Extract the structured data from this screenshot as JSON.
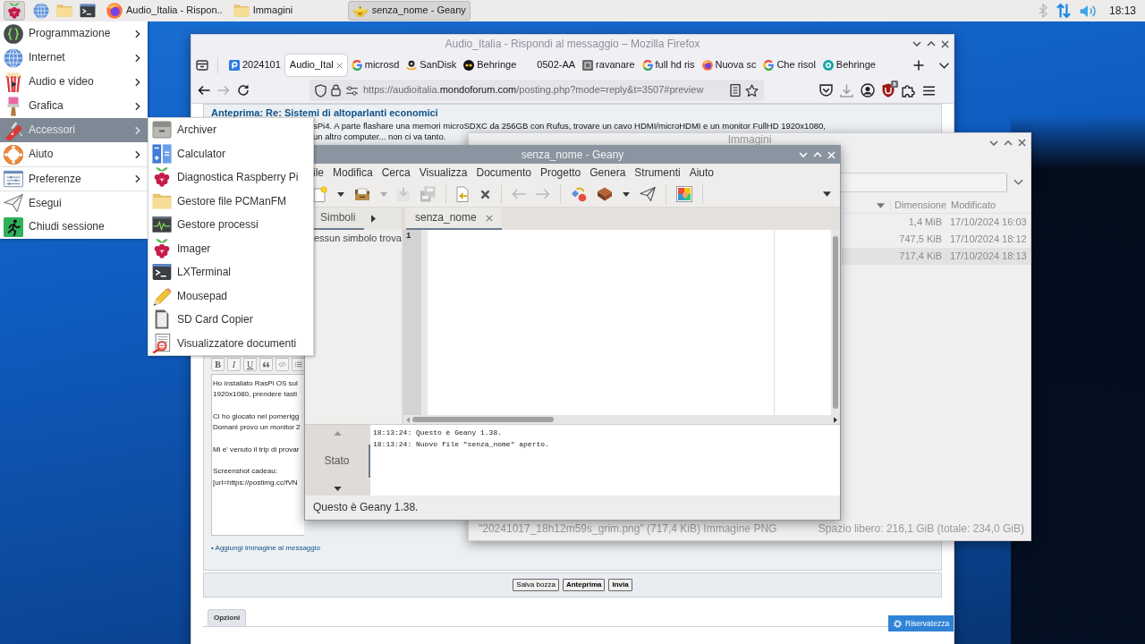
{
  "taskbar": {
    "launchers": [
      {
        "kind": "raspberry",
        "selected": true
      },
      {
        "kind": "globe",
        "selected": false
      },
      {
        "kind": "folder",
        "selected": false
      },
      {
        "kind": "terminal",
        "selected": false
      }
    ],
    "tasks": [
      {
        "kind": "firefox",
        "label": "Audio_Italia - Rispon..",
        "selected": false
      },
      {
        "kind": "folder",
        "label": "Immagini",
        "selected": false
      },
      {
        "kind": "teapot",
        "label": "senza_nome - Geany",
        "selected": true
      }
    ],
    "tray": {
      "bluetooth_enabled": false,
      "clock": "18:13"
    }
  },
  "app_menu": {
    "items": [
      {
        "kind": "braces",
        "label": "Programmazione",
        "submenu": true,
        "selected": false,
        "separator_before": false
      },
      {
        "kind": "globe",
        "label": "Internet",
        "submenu": true,
        "selected": false,
        "separator_before": false
      },
      {
        "kind": "bucket",
        "label": "Audio e video",
        "submenu": true,
        "selected": false,
        "separator_before": false
      },
      {
        "kind": "brush",
        "label": "Grafica",
        "submenu": true,
        "selected": false,
        "separator_before": false
      },
      {
        "kind": "knife",
        "label": "Accessori",
        "submenu": true,
        "selected": true,
        "separator_before": false
      },
      {
        "kind": "lifebuoy",
        "label": "Aiuto",
        "submenu": true,
        "selected": false,
        "separator_before": false
      },
      {
        "kind": "settings",
        "label": "Preferenze",
        "submenu": true,
        "selected": false,
        "separator_before": true
      },
      {
        "kind": "plane",
        "label": "Esegui",
        "submenu": false,
        "selected": false,
        "separator_before": true
      },
      {
        "kind": "exit",
        "label": "Chiudi sessione",
        "submenu": false,
        "selected": false,
        "separator_before": false
      }
    ]
  },
  "submenu": {
    "items": [
      {
        "kind": "drawer",
        "label": "Archiver"
      },
      {
        "kind": "calculator",
        "label": "Calculator"
      },
      {
        "kind": "raspberry",
        "label": "Diagnostica Raspberry Pi"
      },
      {
        "kind": "folder",
        "label": "Gestore file PCManFM"
      },
      {
        "kind": "waveform",
        "label": "Gestore processi"
      },
      {
        "kind": "raspberry",
        "label": "Imager"
      },
      {
        "kind": "terminal",
        "label": "LXTerminal"
      },
      {
        "kind": "pencil",
        "label": "Mousepad"
      },
      {
        "kind": "sdcard",
        "label": "SD Card Copier"
      },
      {
        "kind": "docviewer",
        "label": "Visualizzatore documenti"
      }
    ]
  },
  "firefox": {
    "title": "Audio_Italia - Rispondi al messaggio – Mozilla Firefox",
    "tabs": [
      {
        "kind": "square",
        "label": "2024101",
        "selected": false
      },
      {
        "kind": "square_none",
        "label": "Audio_Ital",
        "selected": true
      },
      {
        "kind": "ring",
        "label": "microsd",
        "selected": false
      },
      {
        "kind": "smile",
        "label": "SanDisk",
        "selected": false
      },
      {
        "kind": "disc",
        "label": "Behringe",
        "selected": false
      },
      {
        "kind": "none",
        "label": "0502-AA",
        "selected": false
      },
      {
        "kind": "tile",
        "label": "ravanare",
        "selected": false
      },
      {
        "kind": "ring",
        "label": "full hd ris",
        "selected": false
      },
      {
        "kind": "firefox",
        "label": "Nuova sc",
        "selected": false
      },
      {
        "kind": "ring",
        "label": "Che risol",
        "selected": false
      },
      {
        "kind": "teal",
        "label": "Behringe",
        "selected": false
      }
    ],
    "forward_disabled": true,
    "url": "https://audioitalia.**mondoforum.com**/posting.php?mode=reply&t=3507#preview",
    "page": {
      "heading": "Anteprima: Re: Sistemi di altoparlanti economici",
      "preview_lines": [
        "sPi4. A parte flashare una memori microSDXC da 256GB con Rufus, trovare un cavo HDMI/microHDMI e un monitor FullHD 1920x1080,",
        "un altro computer... non ci va tanto."
      ],
      "format_buttons": [
        {
          "kind": "bold",
          "label": "B"
        },
        {
          "kind": "italic",
          "label": "I"
        },
        {
          "kind": "underline",
          "label": "U"
        },
        {
          "kind": "quote"
        },
        {
          "kind": "code"
        },
        {
          "kind": "list"
        }
      ],
      "message_paragraphs": [
        [
          "Ho installato RasPi OS sul",
          "1920x1080, prendere tasti"
        ],
        [
          "Ci ho giocato nel pomerigg",
          "Domani provo un monitor 2"
        ],
        [
          "Mi e' venuto il trip di provar"
        ],
        [
          "Screenshot cadeau:",
          "[url=https://postimg.cc/fVN"
        ]
      ],
      "add_image_link": "• Aggiungi immagine al messaggio",
      "buttons": [
        {
          "kind": "secondary",
          "label": "Salva bozza"
        },
        {
          "kind": "primary",
          "label": "Anteprima"
        },
        {
          "kind": "primary",
          "label": "Invia"
        }
      ],
      "options_tab": "Opzioni",
      "privacy_button": "Riservatezza"
    }
  },
  "file_manager": {
    "title": "Immagini",
    "columns": [
      "Dimensione",
      "Modificato"
    ],
    "rows": [
      {
        "size": "1,4 MiB",
        "modified": "17/10/2024 16:03",
        "selected": false
      },
      {
        "size": "747,5 KiB",
        "modified": "17/10/2024 18:12",
        "selected": false
      },
      {
        "size": "717,4 KiB",
        "modified": "17/10/2024 18:13",
        "selected": true
      }
    ],
    "status": "\"20241017_18h12m59s_grim.png\" (717,4 KiB) Immagine PNG",
    "free_space": "Spazio libero: 216,1 GiB (totale: 234,0 GiB)"
  },
  "geany": {
    "title": "senza_nome - Geany",
    "menu": [
      "ile",
      "Modifica",
      "Cerca",
      "Visualizza",
      "Documento",
      "Progetto",
      "Genera",
      "Strumenti",
      "Aiuto"
    ],
    "toolbar": [
      [
        {
          "kind": "new",
          "disabled": false
        },
        {
          "kind": "caret",
          "disabled": false
        },
        {
          "kind": "open",
          "disabled": false
        },
        {
          "kind": "caret",
          "disabled": true
        },
        {
          "kind": "save",
          "disabled": true
        },
        {
          "kind": "save_all",
          "disabled": true
        }
      ],
      [
        {
          "kind": "revert",
          "disabled": false
        },
        {
          "kind": "close",
          "disabled": false
        }
      ],
      [
        {
          "kind": "back",
          "disabled": true
        },
        {
          "kind": "forward",
          "disabled": true
        }
      ],
      [
        {
          "kind": "compile",
          "disabled": false
        },
        {
          "kind": "build",
          "disabled": false
        },
        {
          "kind": "caret",
          "disabled": false
        },
        {
          "kind": "run",
          "disabled": false
        }
      ],
      [
        {
          "kind": "color",
          "disabled": false
        }
      ]
    ],
    "sidebar": {
      "tabs": [
        {
          "label": "Simboli",
          "selected": true
        }
      ],
      "text": "essun simbolo trova"
    },
    "documents": [
      {
        "label": "senza_nome",
        "selected": true
      }
    ],
    "line_numbers": [
      "1"
    ],
    "message_tabs": [
      {
        "label": "Stato",
        "selected": true
      }
    ],
    "messages": [
      "18:13:24: Questo è Geany 1.38.",
      "18:13:24: Nuovo file \"senza_nome\" aperto."
    ],
    "status": "Questo è Geany 1.38."
  }
}
